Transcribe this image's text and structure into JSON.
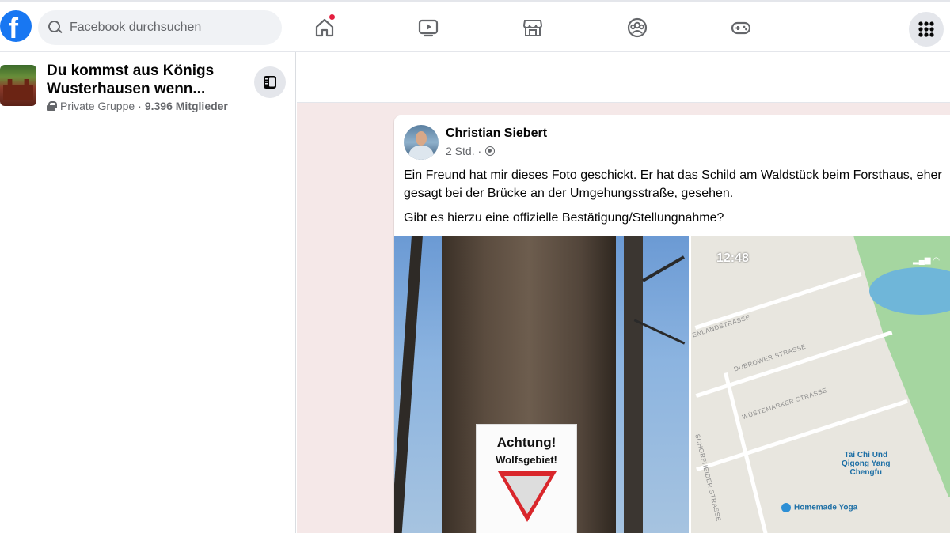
{
  "topbar": {
    "logo_letter": "f",
    "search_placeholder": "Facebook durchsuchen",
    "nav_icons": [
      "home-icon",
      "video-icon",
      "marketplace-icon",
      "groups-icon",
      "gaming-icon"
    ],
    "menu_icon": "grid-menu-icon"
  },
  "sidebar": {
    "group_name": "Du kommst aus Königs Wusterhausen wenn...",
    "privacy": "Private Gruppe",
    "separator": "·",
    "members": "9.396 Mitglieder"
  },
  "post": {
    "author": "Christian Siebert",
    "time": "2 Std. ·",
    "text_1": "Ein Freund hat mir dieses Foto geschickt. Er hat das Schild am Waldstück beim Forsthaus, eher gesagt bei der Brücke an der Umgehungsstraße, gesehen.",
    "text_2": "Gibt es hierzu eine offizielle Bestätigung/Stellungnahme?",
    "sign_title": "Achtung!",
    "sign_sub": "Wolfsgebiet!",
    "map": {
      "status_time": "12:48",
      "streets": [
        "ENLANDSTRASSE",
        "DUBROWER STRASSE",
        "WÜSTEMARKER STRASSE",
        "SCHORFHEIDER STRASSE"
      ],
      "poi_1_line1": "Tai Chi Und",
      "poi_1_line2": "Qigong Yang",
      "poi_1_line3": "Chengfu",
      "poi_2": "Homemade Yoga"
    }
  },
  "colors": {
    "brand": "#1877f2",
    "notification": "#e41e3f",
    "feed_background": "#f5e8e8"
  }
}
